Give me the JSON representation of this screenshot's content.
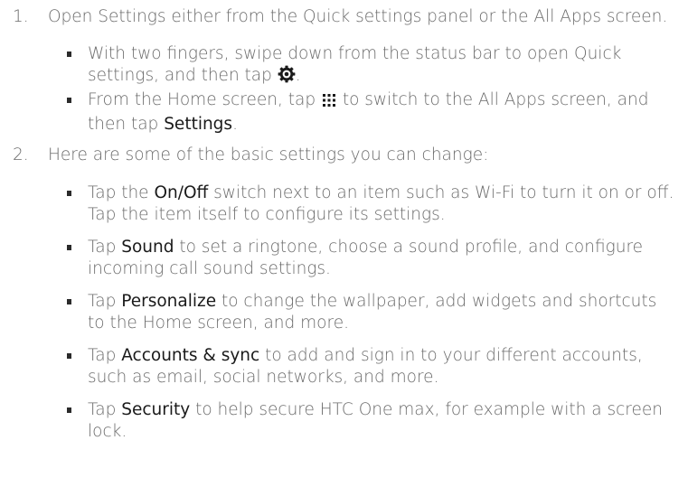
{
  "steps": [
    {
      "number": "1.",
      "text": "Open Settings either from the Quick settings panel or the All Apps screen.",
      "bullets": [
        {
          "pre": "With two fingers, swipe down from the status bar to open Quick settings, and then tap ",
          "icon": "gear-icon",
          "post": "."
        },
        {
          "pre": "From the Home screen, tap ",
          "icon": "all-apps-grid-icon",
          "mid": " to switch to the All Apps screen, and then tap ",
          "term": "Settings",
          "post": "."
        }
      ]
    },
    {
      "number": "2.",
      "text": "Here are some of the basic settings you can change:",
      "bullets": [
        {
          "pre": "Tap the ",
          "term": "On/Off",
          "post": " switch next to an item such as Wi-Fi to turn it on or off. Tap the item itself to configure its settings."
        },
        {
          "pre": "Tap ",
          "term": "Sound",
          "post": " to set a ringtone, choose a sound profile, and configure incoming call sound settings."
        },
        {
          "pre": "Tap ",
          "term": "Personalize",
          "post": " to change the wallpaper, add widgets and shortcuts to the Home screen, and more."
        },
        {
          "pre": "Tap ",
          "term": "Accounts & sync",
          "post": " to add and sign in to your different accounts, such as email, social networks, and more."
        },
        {
          "pre": "Tap ",
          "term": "Security",
          "post": " to help secure HTC One max, for example with a screen lock."
        }
      ]
    }
  ]
}
